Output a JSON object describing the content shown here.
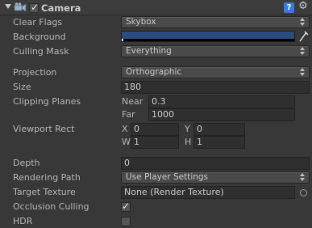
{
  "component": {
    "title": "Camera",
    "enabled": true,
    "help_icon": "book-icon",
    "settings_icon": "gear-icon",
    "collapse_icon": "foldout-triangle-icon",
    "component_icon": "camera-icon"
  },
  "fields": {
    "clear_flags": {
      "label": "Clear Flags",
      "value": "Skybox"
    },
    "background": {
      "label": "Background",
      "color": "#2a4b7d"
    },
    "culling_mask": {
      "label": "Culling Mask",
      "value": "Everything"
    },
    "projection": {
      "label": "Projection",
      "value": "Orthographic"
    },
    "size": {
      "label": "Size",
      "value": "180"
    },
    "clipping_planes": {
      "label": "Clipping Planes",
      "near_label": "Near",
      "near_value": "0.3",
      "far_label": "Far",
      "far_value": "1000"
    },
    "viewport_rect": {
      "label": "Viewport Rect",
      "x_label": "X",
      "x_value": "0",
      "y_label": "Y",
      "y_value": "0",
      "w_label": "W",
      "w_value": "1",
      "h_label": "H",
      "h_value": "1"
    },
    "depth": {
      "label": "Depth",
      "value": "0"
    },
    "rendering_path": {
      "label": "Rendering Path",
      "value": "Use Player Settings"
    },
    "target_texture": {
      "label": "Target Texture",
      "value": "None (Render Texture)"
    },
    "occlusion_culling": {
      "label": "Occlusion Culling",
      "checked": true
    },
    "hdr": {
      "label": "HDR",
      "checked": false
    }
  },
  "colors": {
    "panel_bg": "#383838",
    "header_bg": "#3c3c3c",
    "background_color": "#2a4b7d",
    "help_icon_blue": "#3d7ad8"
  }
}
